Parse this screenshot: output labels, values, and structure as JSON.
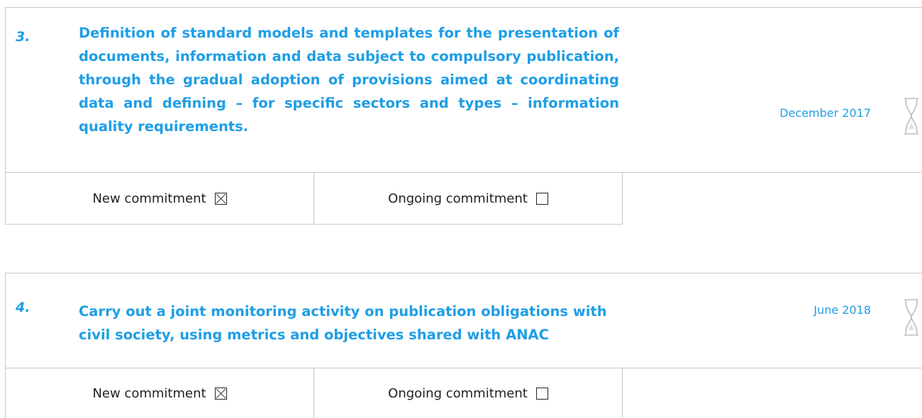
{
  "commitments": [
    {
      "number": "3.",
      "title": "Definition of standard models and templates for the presentation of documents, information and data subject to compulsory publication, through the gradual adoption of provisions aimed at coordinating data and defining – for specific sectors and types – information quality requirements.",
      "deadline": "December 2017",
      "status_icon": "hourglass-icon",
      "new_label": "New commitment",
      "new_checked": true,
      "ongoing_label": "Ongoing commitment",
      "ongoing_checked": false
    },
    {
      "number": "4.",
      "title": "Carry out a joint monitoring activity on publication obligations with civil society, using metrics and objectives shared with ANAC",
      "deadline": "June 2018",
      "status_icon": "hourglass-icon",
      "new_label": "New commitment",
      "new_checked": true,
      "ongoing_label": "Ongoing commitment",
      "ongoing_checked": false
    }
  ],
  "colors": {
    "accent": "#1e9ee6",
    "border": "#c8c8c8",
    "text": "#222222",
    "icon": "#bdbdbd"
  }
}
